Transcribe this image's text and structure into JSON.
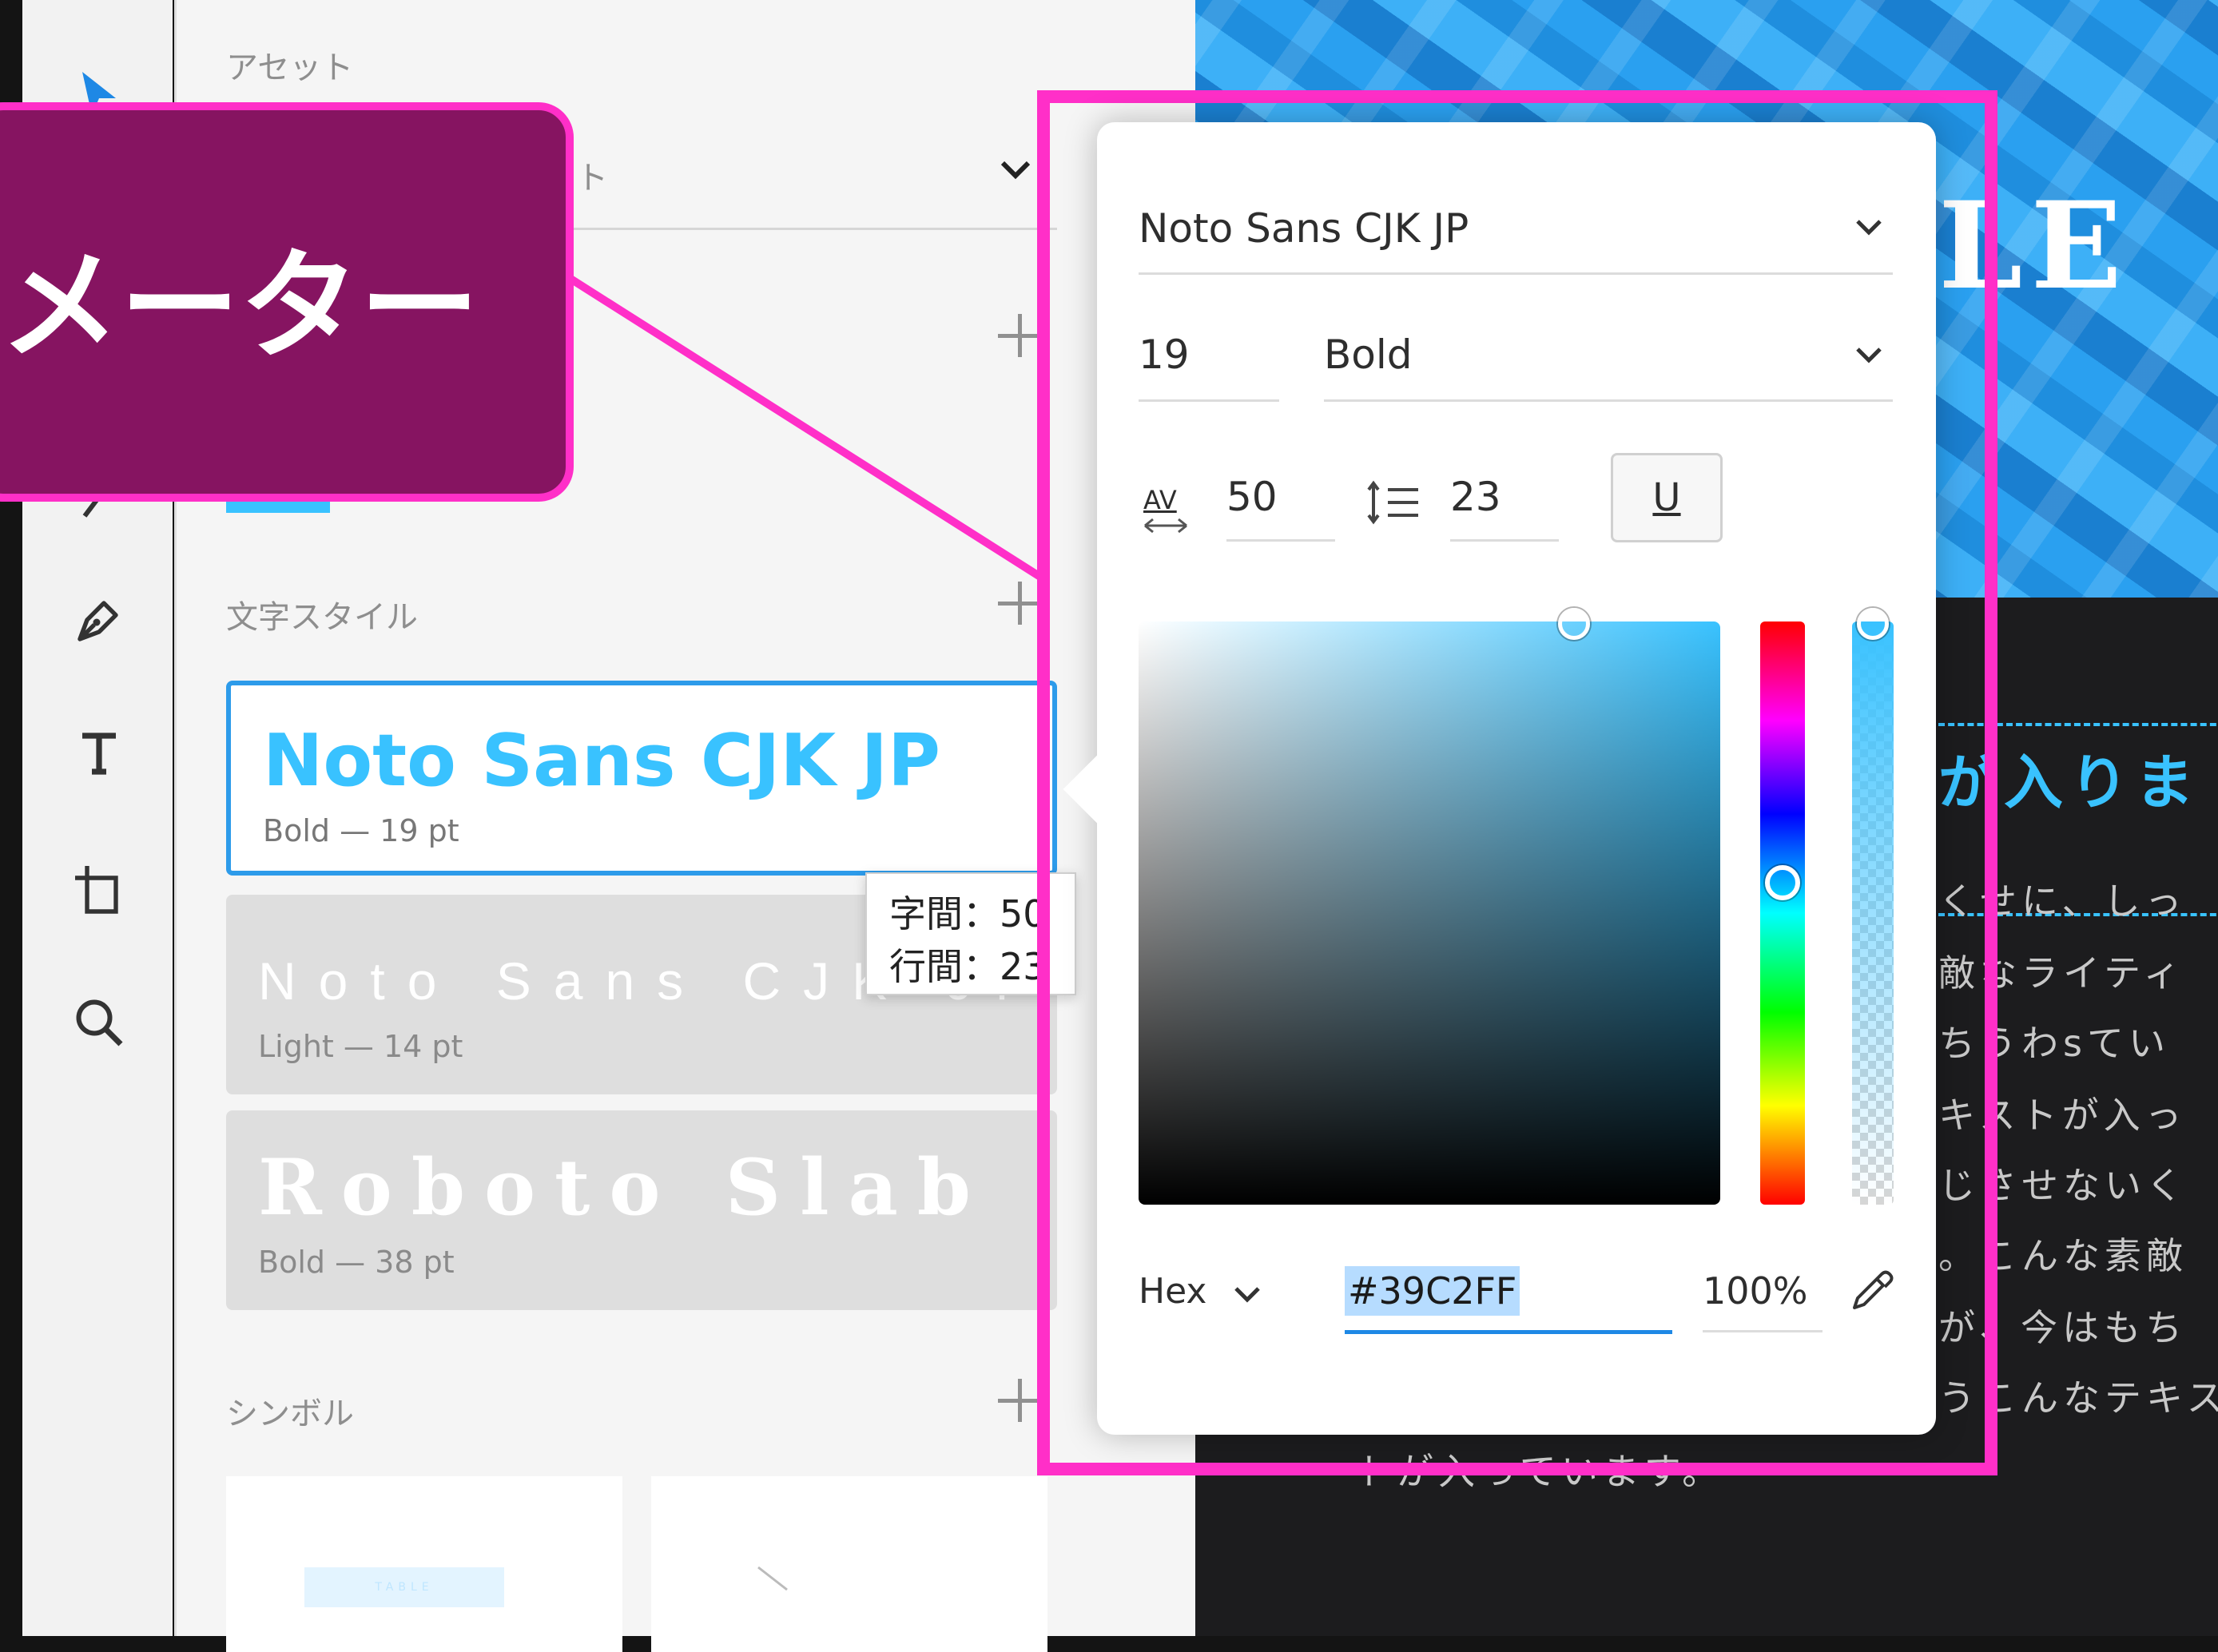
{
  "panel": {
    "assets_label": "アセット",
    "dropdown_fragment": "ト",
    "char_styles_label": "文字スタイル",
    "symbols_label": "シンボル",
    "symbol_thumb_text": "TABLE"
  },
  "char_styles": [
    {
      "name": "Noto Sans CJK JP",
      "meta": "Bold — 19 pt"
    },
    {
      "name": "Noto Sans CJK JP",
      "meta": "Light — 14 pt"
    },
    {
      "name": "Roboto Slab",
      "meta": "Bold — 38 pt"
    }
  ],
  "tooltip": {
    "line1": "字間：50",
    "line2": "行間：23"
  },
  "callout": {
    "text": "メーター"
  },
  "popover": {
    "font_family": "Noto Sans CJK JP",
    "font_size": "19",
    "font_weight": "Bold",
    "char_spacing_icon": "AV",
    "char_spacing": "50",
    "line_height": "23",
    "underline_label": "U",
    "color_mode": "Hex",
    "hex_value": "#39C2FF",
    "opacity": "100%"
  },
  "canvas": {
    "hero_title_fragment": "LE",
    "heading_fragment": "が入りま",
    "body_lines": [
      "くせに、しっ",
      "敵なライティ",
      "ちうわsてい",
      "キストが入っ",
      "じさせないく",
      "。こんな素敵",
      "が、今はもち",
      "うこんなテキス",
      "トが入っています。"
    ]
  },
  "colors": {
    "accent": "#39C2FF",
    "highlight": "#FF2FC8",
    "callout_bg": "#861461",
    "selection_border": "#2D9BEA"
  }
}
